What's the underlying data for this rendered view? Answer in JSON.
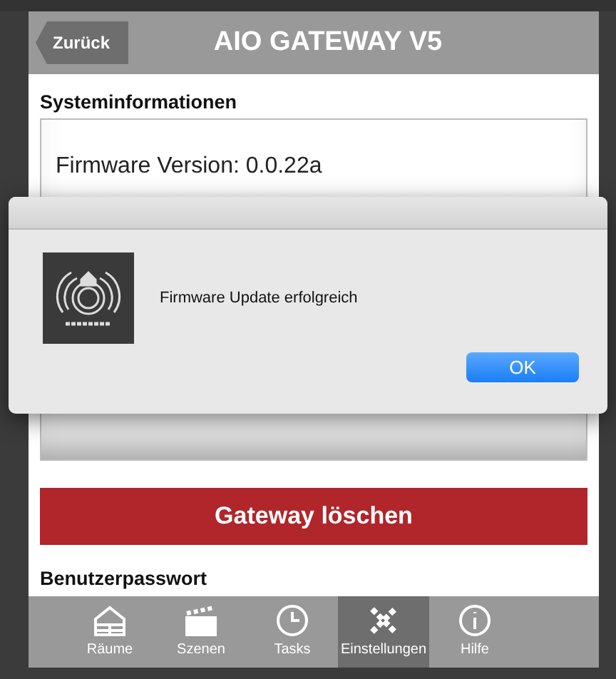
{
  "header": {
    "back_button": "Zurück",
    "title": "AIO GATEWAY V5"
  },
  "system_info": {
    "heading": "Systeminformationen",
    "firmware": "Firmware Version: 0.0.22a"
  },
  "delete_button": "Gateway löschen",
  "password_heading": "Benutzerpasswort",
  "tabs": [
    {
      "label": "Räume",
      "kind": "rooms",
      "selected": false
    },
    {
      "label": "Szenen",
      "kind": "scenes",
      "selected": false
    },
    {
      "label": "Tasks",
      "kind": "tasks",
      "selected": false
    },
    {
      "label": "Einstellungen",
      "kind": "settings",
      "selected": true
    },
    {
      "label": "Hilfe",
      "kind": "help",
      "selected": false
    }
  ],
  "dialog": {
    "message": "Firmware Update erfolgreich",
    "ok_button": "OK"
  }
}
